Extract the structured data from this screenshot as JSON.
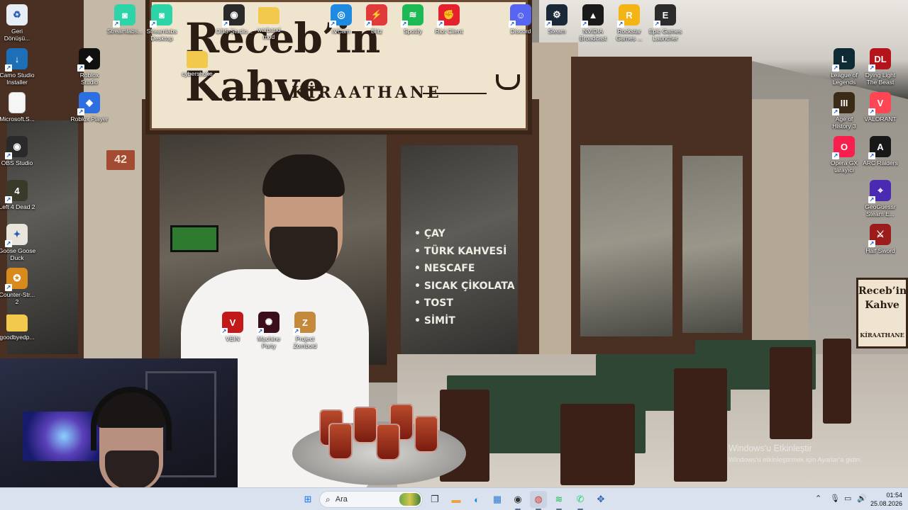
{
  "wallpaper": {
    "sign_title": "Receb’in Kahve",
    "sign_subtitle": "KİRAATHANE",
    "house_number": "42",
    "menu_items": [
      "ÇAY",
      "TÜRK KAHVESİ",
      "NESCAFE",
      "SICAK ÇİKOLATA",
      "TOST",
      "SİMİT"
    ],
    "side_sign_title": "Receb’in Kahve",
    "side_sign_subtitle": "KİRAATHANE"
  },
  "desktop_icons": [
    {
      "label": "Geri\nDönüşü...",
      "icon": "recycle-bin-icon",
      "color": "#e8eef5",
      "glyph": "♻"
    },
    {
      "label": "Camo Studio\nInstaller",
      "icon": "camo-studio-icon",
      "color": "#1d6fb8",
      "glyph": "↓"
    },
    {
      "label": "Microsoft.S...",
      "icon": "document-icon",
      "color": "#f5f5f5",
      "glyph": ""
    },
    {
      "label": "OBS Studio",
      "icon": "obs-studio-icon",
      "color": "#2a2a2a",
      "glyph": "◉"
    },
    {
      "label": "Left 4 Dead 2",
      "icon": "left4dead-icon",
      "color": "#3a3a2a",
      "glyph": "4"
    },
    {
      "label": "Goose Goose\nDuck",
      "icon": "goose-goose-duck-icon",
      "color": "#e9e4dc",
      "glyph": "✦"
    },
    {
      "label": "Counter-Str...\n2",
      "icon": "counter-strike-icon",
      "color": "#d88a1c",
      "glyph": "✪"
    },
    {
      "label": "goodbyedp...",
      "icon": "folder-icon",
      "color": "#f2c94c",
      "glyph": ""
    },
    {
      "label": "Streamlabs...",
      "icon": "streamlabs-icon",
      "color": "#2dd4a8",
      "glyph": "◙"
    },
    {
      "label": "Roblox\nStudio",
      "icon": "roblox-studio-icon",
      "color": "#101010",
      "glyph": "◆"
    },
    {
      "label": "Roblox Player",
      "icon": "roblox-player-icon",
      "color": "#2b6fe0",
      "glyph": "◆"
    },
    {
      "label": "Streamlabs\nDesktop",
      "icon": "streamlabs-desktop-icon",
      "color": "#2dd4a8",
      "glyph": "◙"
    },
    {
      "label": "cybershoke",
      "icon": "folder-icon",
      "color": "#f2c94c",
      "glyph": ""
    },
    {
      "label": "OBS-Studio...",
      "icon": "obs-studio-icon",
      "color": "#2a2a2a",
      "glyph": "◉"
    },
    {
      "label": "warband\nmod",
      "icon": "folder-icon",
      "color": "#f2c94c",
      "glyph": ""
    },
    {
      "label": "iVCam",
      "icon": "ivcam-icon",
      "color": "#1f8be0",
      "glyph": "◎"
    },
    {
      "label": "Blitz",
      "icon": "blitz-icon",
      "color": "#e03a3a",
      "glyph": "⚡"
    },
    {
      "label": "Spotify",
      "icon": "spotify-icon",
      "color": "#1db954",
      "glyph": "≋"
    },
    {
      "label": "Riot Client",
      "icon": "riot-client-icon",
      "color": "#e5212e",
      "glyph": "✊"
    },
    {
      "label": "Discord",
      "icon": "discord-icon",
      "color": "#5865f2",
      "glyph": "☺"
    },
    {
      "label": "Steam",
      "icon": "steam-icon",
      "color": "#1b2838",
      "glyph": "⚙"
    },
    {
      "label": "NVIDIA\nBroadcast",
      "icon": "nvidia-broadcast-icon",
      "color": "#1a1a1a",
      "glyph": "▲"
    },
    {
      "label": "Rockstar\nGames ...",
      "icon": "rockstar-games-icon",
      "color": "#f5b416",
      "glyph": "R"
    },
    {
      "label": "Epic Games\nLauncher",
      "icon": "epic-games-icon",
      "color": "#2b2b2b",
      "glyph": "E"
    },
    {
      "label": "League of\nLegends",
      "icon": "league-of-legends-icon",
      "color": "#0d2a35",
      "glyph": "L"
    },
    {
      "label": "Dying Light\nThe Beast",
      "icon": "dying-light-icon",
      "color": "#b5141c",
      "glyph": "DL"
    },
    {
      "label": "Age of\nHistory 3",
      "icon": "age-of-history-icon",
      "color": "#3a2a16",
      "glyph": "III"
    },
    {
      "label": "VALORANT",
      "icon": "valorant-icon",
      "color": "#ff4655",
      "glyph": "V"
    },
    {
      "label": "Opera GX\ntarayıcı",
      "icon": "opera-gx-icon",
      "color": "#fa1e4e",
      "glyph": "O"
    },
    {
      "label": "ARC Raiders",
      "icon": "arc-raiders-icon",
      "color": "#181818",
      "glyph": "A"
    },
    {
      "label": "GeoGuessr\nSteam E...",
      "icon": "geoguessr-icon",
      "color": "#4b2ab3",
      "glyph": "⌖"
    },
    {
      "label": "Half Sword",
      "icon": "half-sword-icon",
      "color": "#9c1c1c",
      "glyph": "⚔"
    },
    {
      "label": "VEIN",
      "icon": "vein-icon",
      "color": "#c21a1a",
      "glyph": "V"
    },
    {
      "label": "Machine\nParty",
      "icon": "machine-party-icon",
      "color": "#3a0f1a",
      "glyph": "✺"
    },
    {
      "label": "Project\nZomboid",
      "icon": "project-zomboid-icon",
      "color": "#c4893a",
      "glyph": "Z"
    }
  ],
  "activation_watermark": {
    "title": "Windows'u Etkinleştir",
    "subtitle": "Windows'u etkinleştirmek için Ayarlar'a gidin."
  },
  "taskbar": {
    "search_placeholder": "Ara",
    "apps": [
      {
        "name": "start-button",
        "glyph": "⊞",
        "color": "#1a73e8"
      },
      {
        "name": "task-view-button",
        "glyph": "❐",
        "color": "#333"
      },
      {
        "name": "file-explorer-icon",
        "glyph": "▬",
        "color": "#e8a33d"
      },
      {
        "name": "edge-icon",
        "glyph": "◐",
        "color": "#1b8ad6"
      },
      {
        "name": "microsoft-store-icon",
        "glyph": "▦",
        "color": "#2e7ad1"
      },
      {
        "name": "obs-studio-icon",
        "glyph": "◉",
        "color": "#333"
      },
      {
        "name": "chrome-icon",
        "glyph": "◍",
        "color": "#d93a2b"
      },
      {
        "name": "spotify-icon",
        "glyph": "≋",
        "color": "#1db954"
      },
      {
        "name": "whatsapp-icon",
        "glyph": "✆",
        "color": "#25d366"
      },
      {
        "name": "widgets-icon",
        "glyph": "✥",
        "color": "#2b5fa8"
      }
    ],
    "time": "01:54",
    "date": "25.08.2026"
  }
}
